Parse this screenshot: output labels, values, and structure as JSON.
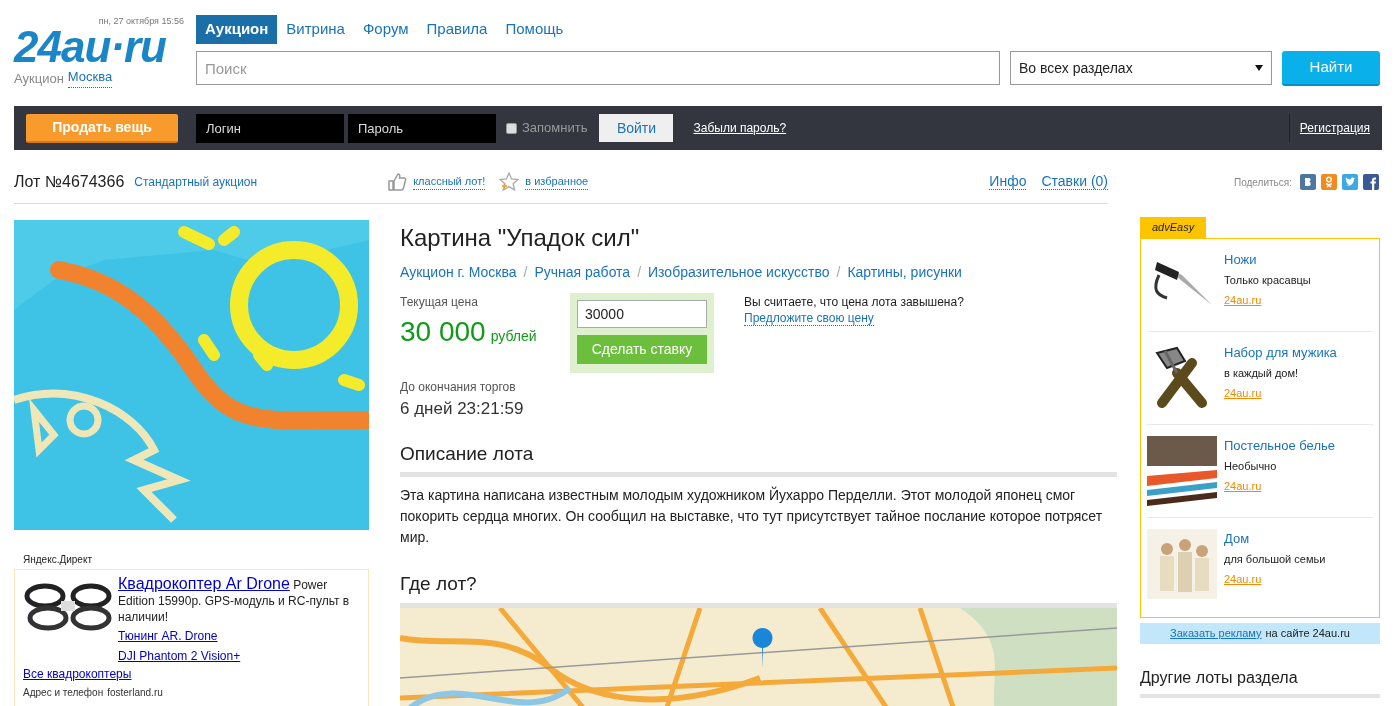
{
  "header": {
    "date": "пн, 27 октября 15:56",
    "logo": "24au·ru",
    "city_label": "Аукцион",
    "city": "Москва",
    "nav": [
      {
        "label": "Аукцион",
        "selected": true
      },
      {
        "label": "Витрина",
        "selected": false
      },
      {
        "label": "Форум",
        "selected": false
      },
      {
        "label": "Правила",
        "selected": false
      },
      {
        "label": "Помощь",
        "selected": false
      }
    ],
    "search": {
      "placeholder": "Поиск"
    },
    "section_select": "Во всех разделах",
    "search_button": "Найти"
  },
  "user_bar": {
    "sell_button": "Продать вещь",
    "login": {
      "placeholder": "Логин"
    },
    "password": {
      "placeholder": "Пароль"
    },
    "remember": {
      "label": "Запомнить",
      "checked": false
    },
    "login_button": "Войти",
    "forgot": "Забыли пароль?",
    "register": "Регистрация"
  },
  "lot_bar": {
    "lot": "Лот №4674366",
    "type": "Стандартный аукцион",
    "like": "классный лот!",
    "favorite": "в избранное",
    "tabs": [
      {
        "label": "Инфо"
      },
      {
        "label": "Ставки (0)"
      }
    ],
    "share_label": "Поделиться:"
  },
  "lot": {
    "title": "Картина \"Упадок сил\"",
    "breadcrumb_separator": "/",
    "breadcrumbs": [
      "Аукцион г. Москва",
      "Ручная работа",
      "Изобразительное искусство",
      "Картины, рисунки"
    ],
    "price_label": "Текущая цена",
    "price": "30 000",
    "currency": "рублей",
    "bid_value": "30000",
    "bid_button": "Сделать ставку",
    "overpriced_question": "Вы считаете, что цена лота завышена?",
    "offer_link": "Предложите свою цену",
    "ends_label": "До окончания торгов",
    "ends": "6 дней 23:21:59",
    "description_title": "Описание лота",
    "description": "Эта картина написана известным молодым художником Йухарро Перделли. Этот молодой японец смог покорить сердца многих. Он сообщил на выставке, что тут присутствует тайное послание которое потрясет мир.",
    "location_title": "Где лот?"
  },
  "direct_ad": {
    "label": "Яндекс.Директ",
    "title": "Квадрокоптер Ar Drone",
    "text": "Power Edition 15990р. GPS-модуль и RC-пульт в наличии!",
    "links": [
      "Тюнинг AR. Drone",
      "DJI Phantom 2 Vision+"
    ],
    "all_link": "Все квадрокоптеры",
    "contact_label": "Адрес и телефон",
    "contact_site": "fosterland.ru"
  },
  "ad_block": {
    "badge": "advEasy",
    "items": [
      {
        "title": "Ножи",
        "text": "Только красавцы",
        "link": "24au.ru",
        "kind": "knife"
      },
      {
        "title": "Набор для мужика",
        "text": "в каждый дом!",
        "link": "24au.ru",
        "kind": "tools"
      },
      {
        "title": "Постельное белье",
        "text": "Необычно",
        "link": "24au.ru",
        "kind": "picture"
      },
      {
        "title": "Дом",
        "text": "для большой семьи",
        "link": "24au.ru",
        "kind": "picture"
      }
    ],
    "order_link": "Заказать рекламу",
    "order_text": "на сайте 24au.ru"
  },
  "other_lots_title": "Другие лоты раздела"
}
